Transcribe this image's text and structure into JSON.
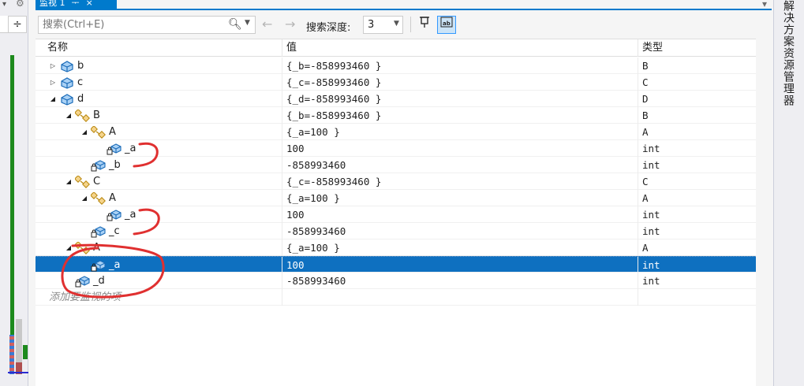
{
  "window": {
    "tab_title": "监视 1",
    "tab_pin": "ᅮ",
    "tab_close": "×",
    "right_panel_label": "解决方案资源管理器"
  },
  "toolbar": {
    "search_placeholder": "搜索(Ctrl+E)",
    "depth_label": "搜索深度:",
    "depth_value": "3"
  },
  "columns": {
    "name": "名称",
    "value": "值",
    "type": "类型"
  },
  "rows": [
    {
      "name": "b",
      "value": "{_b=-858993460 }",
      "type": "B",
      "level": 0,
      "expander": "▷",
      "icon": "object-icon"
    },
    {
      "name": "c",
      "value": "{_c=-858993460 }",
      "type": "C",
      "level": 0,
      "expander": "▷",
      "icon": "object-icon"
    },
    {
      "name": "d",
      "value": "{_d=-858993460 }",
      "type": "D",
      "level": 0,
      "expander": "◢",
      "icon": "object-icon"
    },
    {
      "name": "B",
      "value": "{_b=-858993460 }",
      "type": "B",
      "level": 1,
      "expander": "◢",
      "icon": "base-class-icon"
    },
    {
      "name": "A",
      "value": "{_a=100 }",
      "type": "A",
      "level": 2,
      "expander": "◢",
      "icon": "base-class-icon"
    },
    {
      "name": "_a",
      "value": "100",
      "type": "int",
      "level": 3,
      "expander": "",
      "icon": "private-field-icon"
    },
    {
      "name": "_b",
      "value": "-858993460",
      "type": "int",
      "level": 2,
      "expander": "",
      "icon": "private-field-icon"
    },
    {
      "name": "C",
      "value": "{_c=-858993460 }",
      "type": "C",
      "level": 1,
      "expander": "◢",
      "icon": "base-class-icon"
    },
    {
      "name": "A",
      "value": "{_a=100 }",
      "type": "A",
      "level": 2,
      "expander": "◢",
      "icon": "base-class-icon"
    },
    {
      "name": "_a",
      "value": "100",
      "type": "int",
      "level": 3,
      "expander": "",
      "icon": "private-field-icon"
    },
    {
      "name": "_c",
      "value": "-858993460",
      "type": "int",
      "level": 2,
      "expander": "",
      "icon": "private-field-icon"
    },
    {
      "name": "A",
      "value": "{_a=100 }",
      "type": "A",
      "level": 1,
      "expander": "◢",
      "icon": "base-class-icon"
    },
    {
      "name": "_a",
      "value": "100",
      "type": "int",
      "level": 2,
      "expander": "",
      "icon": "private-field-icon",
      "selected": true
    },
    {
      "name": "_d",
      "value": "-858993460",
      "type": "int",
      "level": 1,
      "expander": "",
      "icon": "private-field-icon"
    }
  ],
  "add_item_placeholder": "添加要监视的项",
  "colors": {
    "accent": "#007acc",
    "selection": "#0e70c0",
    "annotation": "#e03030"
  }
}
